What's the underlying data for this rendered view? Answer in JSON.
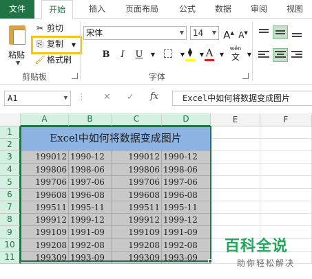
{
  "tabs": [
    {
      "label": "文件",
      "active": false,
      "file": true
    },
    {
      "label": "开始",
      "active": true,
      "file": false
    },
    {
      "label": "插入",
      "active": false,
      "file": false
    },
    {
      "label": "页面布局",
      "active": false,
      "file": false
    },
    {
      "label": "公式",
      "active": false,
      "file": false
    },
    {
      "label": "数据",
      "active": false,
      "file": false
    },
    {
      "label": "审阅",
      "active": false,
      "file": false
    },
    {
      "label": "视图",
      "active": false,
      "file": false
    }
  ],
  "clipboard": {
    "paste_label": "粘贴",
    "cut_label": "剪切",
    "copy_label": "复制",
    "format_painter_label": "格式刷",
    "group_label": "剪贴板"
  },
  "font": {
    "font_name": "宋体",
    "font_size": "14",
    "bold": "B",
    "italic": "I",
    "underline": "U",
    "font_color_glyph": "A",
    "phonetic_top": "wén",
    "phonetic_bottom": "文",
    "grow_glyph": "A",
    "shrink_glyph": "A",
    "group_label": "字体"
  },
  "formula_bar": {
    "name_box": "A1",
    "cancel_symbol": "✕",
    "enter_symbol": "✓",
    "fx_symbol": "fx",
    "content": "Excel中如何将数据变成图片"
  },
  "columns": [
    "A",
    "B",
    "C",
    "D",
    "E",
    "F"
  ],
  "selected_columns": [
    "A",
    "B",
    "C",
    "D"
  ],
  "rows": [
    "1",
    "2",
    "3",
    "4",
    "5",
    "6",
    "7",
    "8",
    "9",
    "10",
    "11"
  ],
  "title_cell": "Excel中如何将数据变成图片",
  "table_rows": [
    [
      "199012",
      "1990-12",
      "199012",
      "1990-12"
    ],
    [
      "199806",
      "1998-06",
      "199806",
      "1998-06"
    ],
    [
      "199706",
      "1997-06",
      "199706",
      "1997-06"
    ],
    [
      "199608",
      "1996-08",
      "199608",
      "1996-08"
    ],
    [
      "199511",
      "1995-11",
      "199511",
      "1995-11"
    ],
    [
      "199912",
      "1999-12",
      "199912",
      "1999-12"
    ],
    [
      "199109",
      "1991-09",
      "199109",
      "1991-09"
    ],
    [
      "199208",
      "1992-08",
      "199208",
      "1992-08"
    ],
    [
      "199309",
      "1993-09",
      "199309",
      "1993-09"
    ]
  ],
  "watermark": {
    "title": "百科全说",
    "subtitle": "助你轻松解决"
  },
  "colors": {
    "accent": "#217346",
    "title_fill": "#8eb4e3",
    "data_fill": "#c8c8c8",
    "highlight": "#f5c518",
    "font_color_bar": "#e21c1c",
    "watermark": "#1fa85a"
  },
  "icons": {
    "cut": "scissors-icon",
    "copy": "copy-icon",
    "format_painter": "paintbrush-icon",
    "fill": "fill-bucket-icon"
  }
}
